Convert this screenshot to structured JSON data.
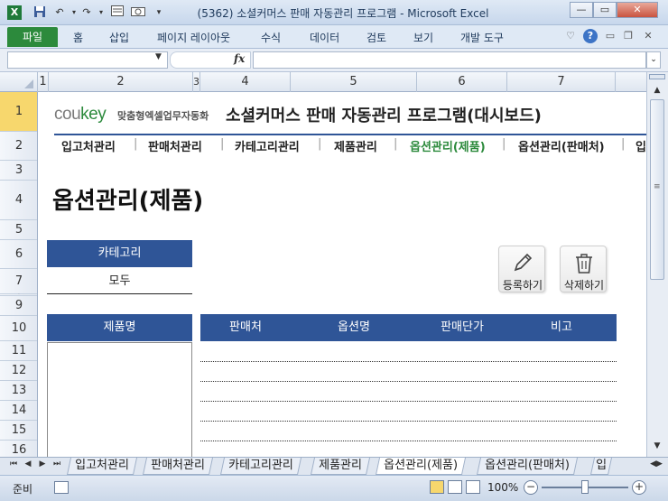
{
  "window": {
    "title": "(5362) 소셜커머스 판매 자동관리 프로그램 - Microsoft Excel",
    "quick_access_icons": [
      "excel-icon",
      "save-icon",
      "undo-icon",
      "redo-icon",
      "form-icon",
      "camera-icon",
      "customize-icon"
    ],
    "controls": [
      "minimize",
      "maximize",
      "close"
    ]
  },
  "ribbon": {
    "file_tab": "파일",
    "tabs": [
      "홈",
      "삽입",
      "페이지 레이아웃",
      "수식",
      "데이터",
      "검토",
      "보기",
      "개발 도구"
    ]
  },
  "formula_bar": {
    "name_box": "",
    "fx": "fx",
    "formula": ""
  },
  "columns": [
    "1",
    "2",
    "3",
    "4",
    "5",
    "6",
    "7"
  ],
  "rows": [
    "1",
    "2",
    "3",
    "4",
    "5",
    "6",
    "7",
    "8",
    "9",
    "10",
    "11",
    "12",
    "13",
    "14",
    "15",
    "16"
  ],
  "header": {
    "logo_main": "cou",
    "logo_accent": "key",
    "logo_sub": "맞춤형엑셀업무자동화",
    "program_title": "소셜커머스 판매 자동관리 프로그램(대시보드)"
  },
  "nav": {
    "items": [
      "입고처관리",
      "판매처관리",
      "카테고리관리",
      "제품관리",
      "옵션관리(제품)",
      "옵션관리(판매처)",
      "입"
    ],
    "active_index": 4,
    "separator": "|"
  },
  "page": {
    "heading": "옵션관리(제품)",
    "category_label": "카테고리",
    "category_value": "모두",
    "register_button": "등록하기",
    "delete_button": "삭제하기",
    "product_list_header": "제품명",
    "option_columns": [
      "판매처",
      "옵션명",
      "판매단가",
      "비고"
    ]
  },
  "sheet_tabs": {
    "tabs": [
      "입고처관리",
      "판매처관리",
      "카테고리관리",
      "제품관리",
      "옵션관리(제품)",
      "옵션관리(판매처)",
      "입"
    ],
    "active_index": 4
  },
  "status_bar": {
    "status": "준비",
    "zoom": "100%"
  }
}
